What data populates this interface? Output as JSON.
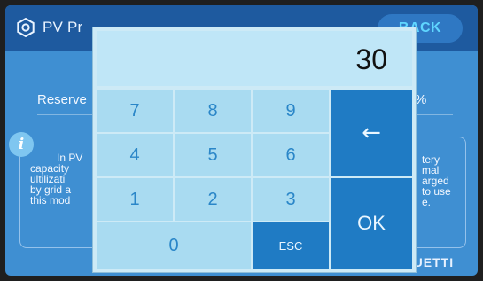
{
  "header": {
    "title": "PV Pr",
    "back_label": "BACK"
  },
  "setting": {
    "reserve_label": "Reserve",
    "unit": "%"
  },
  "info": {
    "left_lines": [
      "In PV",
      "capacity",
      "ultilizati",
      "by grid a",
      "this mod"
    ],
    "right_lines": [
      "tery",
      "mal",
      "arged",
      "to use",
      "e."
    ]
  },
  "brand": "BLUETTI",
  "keypad": {
    "display_value": "30",
    "keys": {
      "k7": "7",
      "k8": "8",
      "k9": "9",
      "k4": "4",
      "k5": "5",
      "k6": "6",
      "k1": "1",
      "k2": "2",
      "k3": "3",
      "k0": "0",
      "esc": "ESC",
      "backspace": "←",
      "ok": "OK"
    }
  },
  "colors": {
    "screen_bg": "#3f8fd2",
    "topbar_bg": "#1e5a9f",
    "keypad_bg": "#cdeaf6",
    "key_bg": "#a9dbf1",
    "key_text": "#2a86c8",
    "dark_key_bg": "#1f7bc4",
    "back_text": "#5fd6ff"
  }
}
